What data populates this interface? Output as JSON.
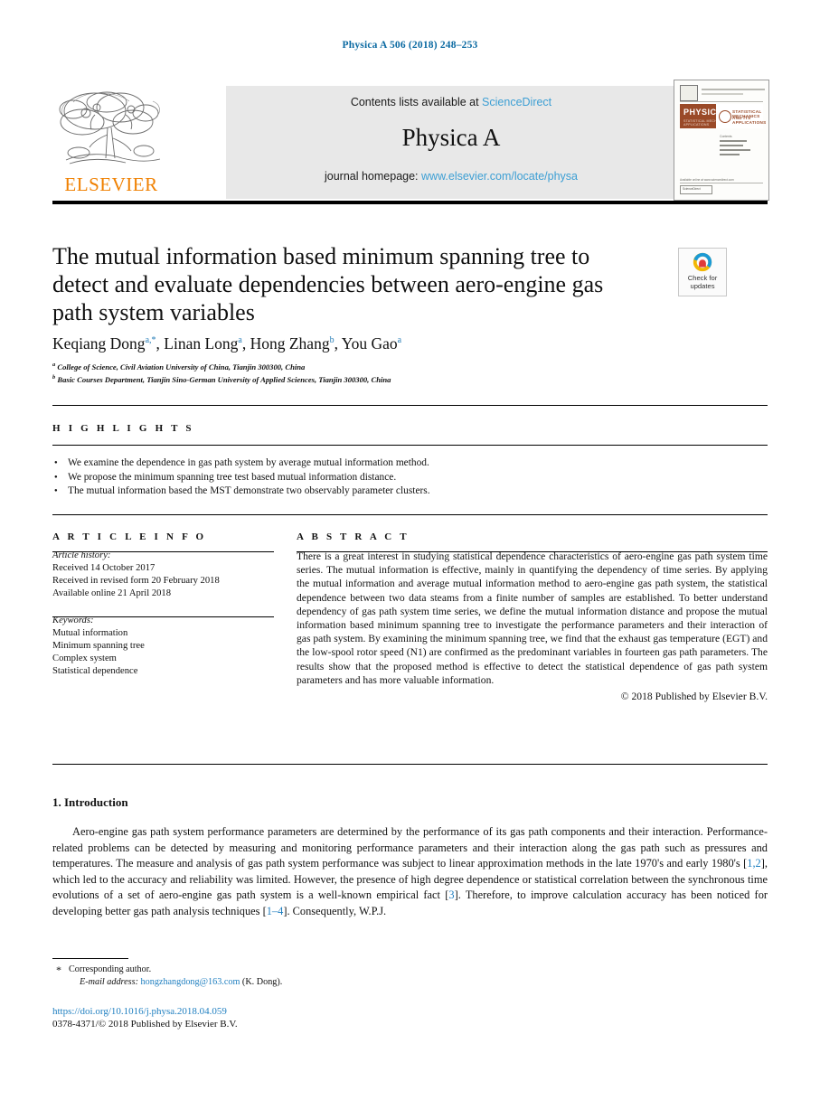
{
  "running_head": "Physica A 506 (2018) 248–253",
  "masthead": {
    "publisher_name": "ELSEVIER",
    "contents_prefix": "Contents lists available at ",
    "contents_link": "ScienceDirect",
    "journal_name": "Physica A",
    "homepage_prefix": "journal homepage: ",
    "homepage_link": "www.elsevier.com/locate/physa",
    "cover": {
      "band_title": "PHYSICA",
      "band_sub": "STATISTICAL MECHANICS AND ITS APPLICATIONS",
      "side_title_line1": "STATISTICAL MECHANICS",
      "side_title_line2": "AND ITS APPLICATIONS",
      "contents_label": "Contents",
      "footer_box": "ScienceDirect",
      "footer_left": "Available online at www.sciencedirect.com",
      "footer_right": "journal homepage: www.elsevier.com/locate/physa"
    }
  },
  "article": {
    "title": "The mutual information based minimum spanning tree to detect and evaluate dependencies between aero-engine gas path system variables",
    "crossmark": {
      "line1": "Check for",
      "line2": "updates"
    },
    "authors": [
      {
        "name": "Keqiang Dong",
        "marks": "a,*"
      },
      {
        "name": "Linan Long",
        "marks": "a"
      },
      {
        "name": "Hong Zhang",
        "marks": "b"
      },
      {
        "name": "You Gao",
        "marks": "a"
      }
    ],
    "affiliations": [
      {
        "mark": "a",
        "text": "College of Science, Civil Aviation University of China, Tianjin 300300, China"
      },
      {
        "mark": "b",
        "text": "Basic Courses Department, Tianjin Sino-German University of Applied Sciences, Tianjin 300300, China"
      }
    ]
  },
  "highlights": {
    "label": "H I G H L I G H T S",
    "items": [
      "We examine the dependence in gas path system by average mutual information method.",
      "We propose the minimum spanning tree test based mutual information distance.",
      "The mutual information based the MST demonstrate two observably parameter clusters."
    ]
  },
  "article_info": {
    "label": "A R T I C L E   I N F O",
    "history_heading": "Article history:",
    "history": [
      "Received 14 October 2017",
      "Received in revised form 20 February 2018",
      "Available online 21 April 2018"
    ],
    "keywords_heading": "Keywords:",
    "keywords": [
      "Mutual information",
      "Minimum spanning tree",
      "Complex system",
      "Statistical dependence"
    ]
  },
  "abstract": {
    "label": "A B S T R A C T",
    "text": "There is a great interest in studying statistical dependence characteristics of aero-engine gas path system time series. The mutual information is effective, mainly in quantifying the dependency of time series. By applying the mutual information and average mutual information method to aero-engine gas path system, the statistical dependence between two data steams from a finite number of samples are established. To better understand dependency of gas path system time series, we define the mutual information distance and propose the mutual information based minimum spanning tree to investigate the performance parameters and their interaction of gas path system. By examining the minimum spanning tree, we find that the exhaust gas temperature (EGT) and the low-spool rotor speed (N1) are confirmed as the predominant variables in fourteen gas path parameters. The results show that the proposed method is effective to detect the statistical dependence of gas path system parameters and has more valuable information.",
    "copyright": "© 2018 Published by Elsevier B.V."
  },
  "introduction": {
    "heading": "1. Introduction",
    "paragraph_part1": "Aero-engine gas path system performance parameters are determined by the performance of its gas path components and their interaction. Performance-related problems can be detected by measuring and monitoring performance parameters and their interaction along the gas path such as pressures and temperatures. The measure and analysis of gas path system performance was subject to linear approximation methods in the late 1970's and early 1980's [",
    "cite1": "1,2",
    "paragraph_part2": "], which led to the accuracy and reliability was limited. However, the presence of high degree dependence or statistical correlation between the synchronous time evolutions of a set of aero-engine gas path system is a well-known empirical fact [",
    "cite2": "3",
    "paragraph_part3": "]. Therefore, to improve calculation accuracy has been noticed for developing better gas path analysis techniques [",
    "cite3": "1–4",
    "paragraph_part4": "]. Consequently, W.P.J."
  },
  "footer": {
    "corresponding": "Corresponding author.",
    "email_label": "E-mail address:",
    "email": "hongzhangdong@163.com",
    "email_suffix": " (K. Dong).",
    "doi": "https://doi.org/10.1016/j.physa.2018.04.059",
    "issn": "0378-4371/© 2018 Published by Elsevier B.V."
  },
  "colors": {
    "link": "#1f7fc0",
    "masthead_link": "#3d9fd4",
    "running_head": "#0b6aa2",
    "elsevier_orange": "#f08000",
    "masthead_bg": "#e8e8e8",
    "cover_band": "#9a4a28"
  }
}
